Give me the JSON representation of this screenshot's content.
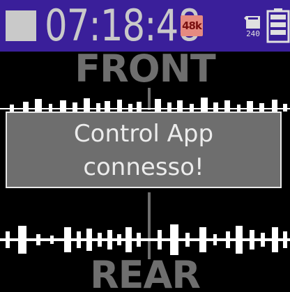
{
  "status_bar": {
    "transport_state_icon": "stop-icon",
    "time": "07:18:48",
    "sample_rate_badge": "48k",
    "card_icon": "sd-card-icon",
    "card_remaining": "240",
    "battery_icon": "battery-icon"
  },
  "meter": {
    "front_label": "FRONT",
    "rear_label": "REAR"
  },
  "dialog": {
    "line1": "Control App",
    "line2": "connesso!"
  },
  "colors": {
    "status_bar_bg": "#3a1f9a",
    "status_text": "#c9c9c9",
    "badge_bg": "#e58a80",
    "dialog_bg": "#6e6e6e",
    "wave": "#ffffff"
  }
}
